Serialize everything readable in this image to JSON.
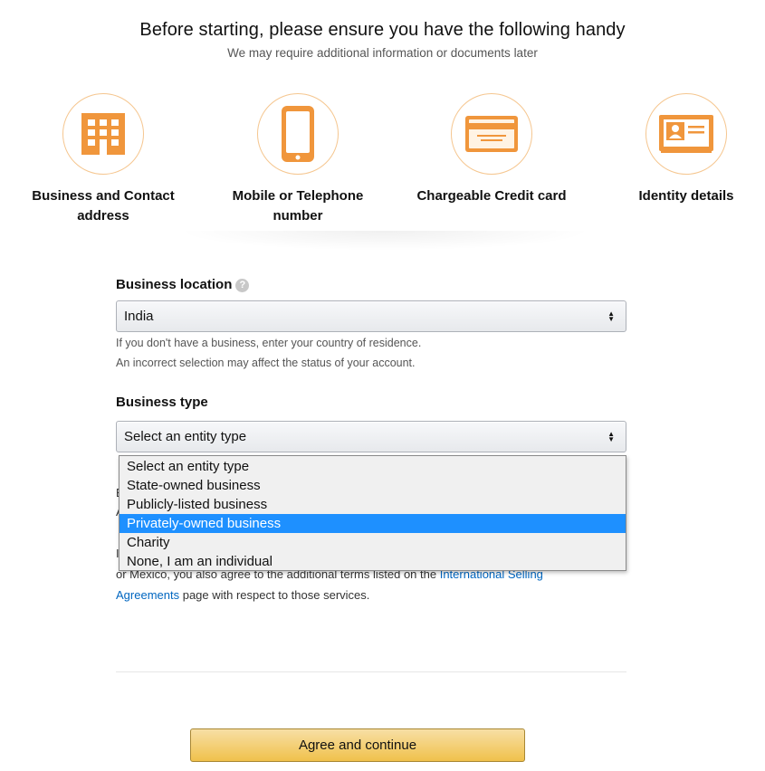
{
  "header": {
    "title": "Before starting, please ensure you have the following handy",
    "subtitle": "We may require additional information or documents later"
  },
  "requirements": [
    {
      "icon": "building-icon",
      "label_line1": "Business and Contact",
      "label_line2": "address"
    },
    {
      "icon": "mobile-phone-icon",
      "label_line1": "Mobile or Telephone number"
    },
    {
      "icon": "credit-card-icon",
      "label_line1": "Chargeable Credit card"
    },
    {
      "icon": "id-card-icon",
      "label_line1": "Identity details"
    }
  ],
  "business_location": {
    "label": "Business location",
    "help_icon": "?",
    "value": "India",
    "hint_line1": "If you don't have a business, enter your country of residence.",
    "hint_line2": "An incorrect selection may affect the status of your account."
  },
  "business_type": {
    "label": "Business type",
    "value": "Select an entity type",
    "options": [
      "Select an entity type",
      "State-owned business",
      "Publicly-listed business",
      "Privately-owned business",
      "Charity",
      "None, I am an individual"
    ],
    "highlighted": "Privately-owned business"
  },
  "obscured": {
    "char1": "E",
    "char2": "A",
    "char3": "I"
  },
  "terms": {
    "line1": "or Mexico, you also agree to the additional terms listed on the",
    "link1": "International Selling",
    "link2": "Agreements",
    "line2_rest": "page with respect to those services."
  },
  "actions": {
    "agree_label": "Agree and continue"
  },
  "colors": {
    "icon_orange": "#f0963c",
    "highlight_blue": "#1e90ff",
    "button_yellow": "#f0c14b",
    "link_blue": "#0066c0"
  }
}
